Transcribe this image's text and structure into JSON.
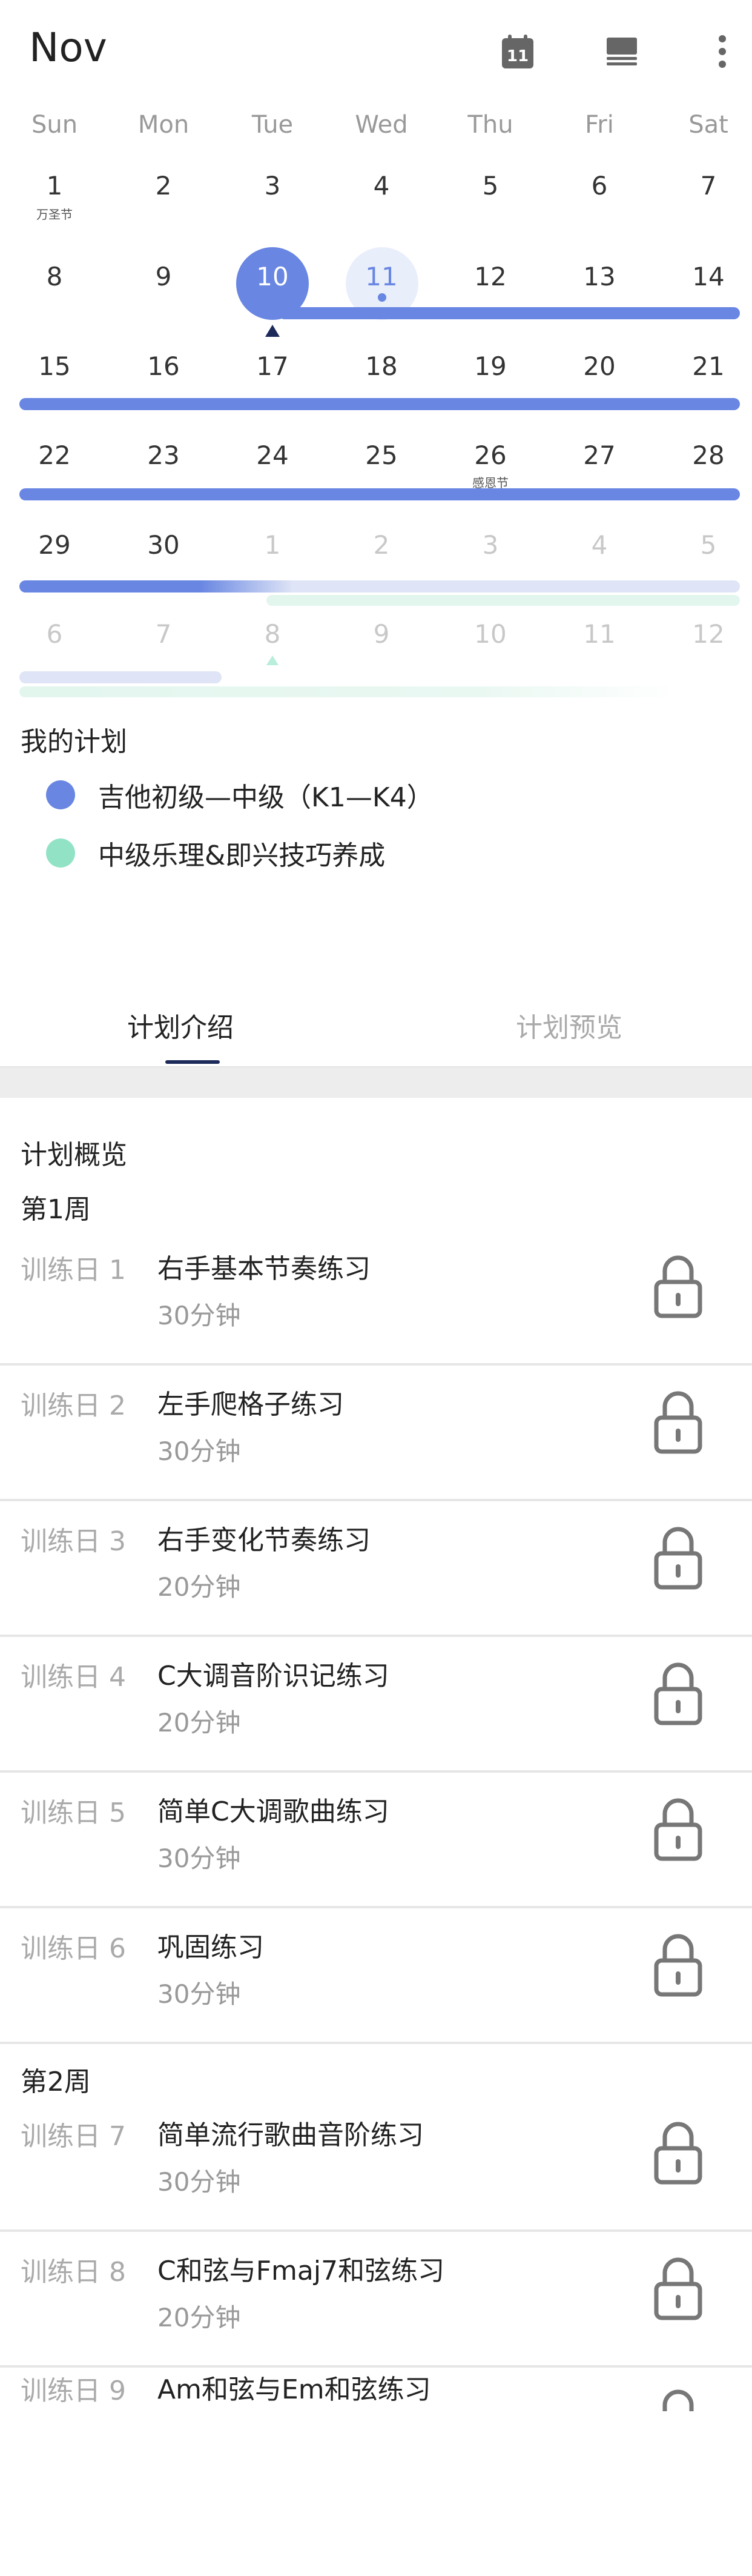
{
  "header": {
    "month": "Nov",
    "calendar_icon_day": "11"
  },
  "weekdays": [
    "Sun",
    "Mon",
    "Tue",
    "Wed",
    "Thu",
    "Fri",
    "Sat"
  ],
  "calendar": {
    "rows": [
      [
        "1",
        "2",
        "3",
        "4",
        "5",
        "6",
        "7"
      ],
      [
        "8",
        "9",
        "10",
        "11",
        "12",
        "13",
        "14"
      ],
      [
        "15",
        "16",
        "17",
        "18",
        "19",
        "20",
        "21"
      ],
      [
        "22",
        "23",
        "24",
        "25",
        "26",
        "27",
        "28"
      ],
      [
        "29",
        "30",
        "1",
        "2",
        "3",
        "4",
        "5"
      ],
      [
        "6",
        "7",
        "8",
        "9",
        "10",
        "11",
        "12"
      ]
    ],
    "festival_1": "万圣节",
    "festival_26": "感恩节"
  },
  "my_plans": {
    "title": "我的计划",
    "items": [
      {
        "label": "吉他初级—中级（K1—K4）",
        "color": "#6886e2"
      },
      {
        "label": "中级乐理&即兴技巧养成",
        "color": "#92e3c5"
      }
    ]
  },
  "tabs": {
    "intro": "计划介绍",
    "preview": "计划预览"
  },
  "overview": {
    "title": "计划概览",
    "week1": "第1周",
    "week2": "第2周",
    "days": [
      {
        "day": "训练日 1",
        "title": "右手基本节奏练习",
        "duration": "30分钟"
      },
      {
        "day": "训练日 2",
        "title": "左手爬格子练习",
        "duration": "30分钟"
      },
      {
        "day": "训练日 3",
        "title": "右手变化节奏练习",
        "duration": "20分钟"
      },
      {
        "day": "训练日 4",
        "title": "C大调音阶识记练习",
        "duration": "20分钟"
      },
      {
        "day": "训练日 5",
        "title": "简单C大调歌曲练习",
        "duration": "30分钟"
      },
      {
        "day": "训练日 6",
        "title": "巩固练习",
        "duration": "30分钟"
      },
      {
        "day": "训练日 7",
        "title": "简单流行歌曲音阶练习",
        "duration": "30分钟"
      },
      {
        "day": "训练日 8",
        "title": "C和弦与Fmaj7和弦练习",
        "duration": "20分钟"
      },
      {
        "day": "训练日 9",
        "title": "Am和弦与Em和弦练习",
        "duration": ""
      }
    ]
  },
  "colors": {
    "accent": "#6886e2",
    "secondary": "#92e3c5",
    "indicator": "#1c2a5a"
  }
}
